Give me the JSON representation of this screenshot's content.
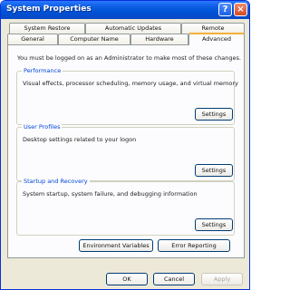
{
  "window": {
    "title": "System Properties"
  },
  "titlebar": {
    "help_label": "?",
    "close_label": "×"
  },
  "tabs": {
    "row_top": [
      "System Restore",
      "Automatic Updates",
      "Remote"
    ],
    "row_bottom": [
      "General",
      "Computer Name",
      "Hardware",
      "Advanced"
    ],
    "active": "Advanced"
  },
  "panel": {
    "note": "You must be logged on as an Administrator to make most of these changes.",
    "groups": [
      {
        "title": "Performance",
        "description": "Visual effects, processor scheduling, memory usage, and virtual memory",
        "button": "Settings"
      },
      {
        "title": "User Profiles",
        "description": "Desktop settings related to your logon",
        "button": "Settings"
      },
      {
        "title": "Startup and Recovery",
        "description": "System startup, system failure, and debugging information",
        "button": "Settings"
      }
    ],
    "environment_variables_label": "Environment Variables",
    "error_reporting_label": "Error Reporting"
  },
  "dialog_buttons": {
    "ok": "OK",
    "cancel": "Cancel",
    "apply": "Apply"
  }
}
